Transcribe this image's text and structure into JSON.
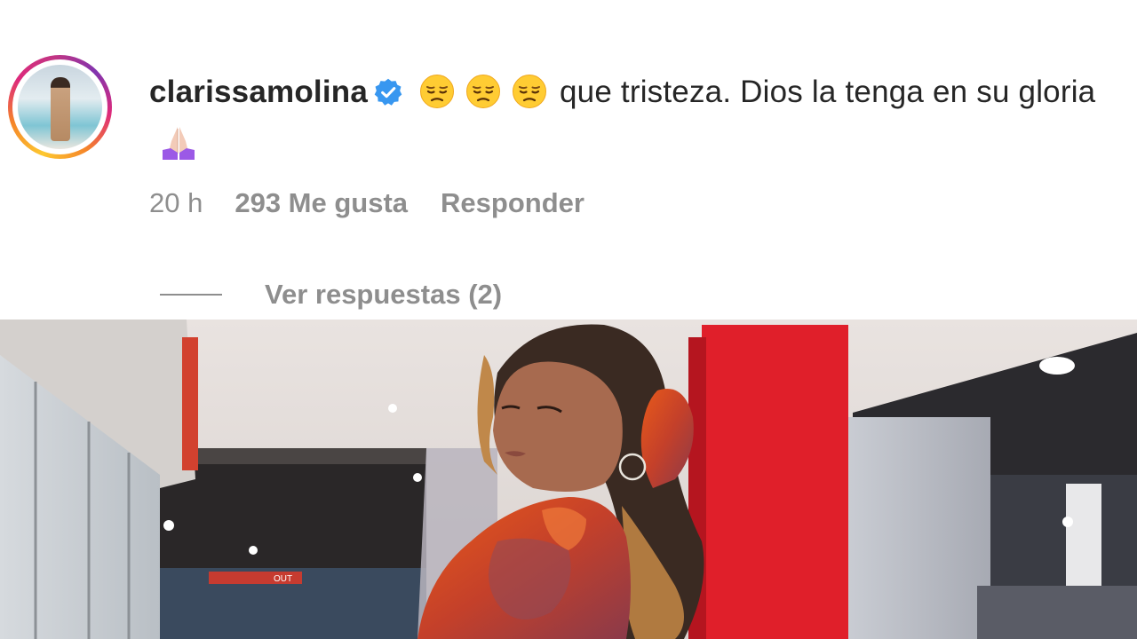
{
  "comment": {
    "username": "clarissamolina",
    "verified_icon": "verified-badge-icon",
    "leading_emojis": [
      "pensive-face-icon",
      "pensive-face-icon",
      "pensive-face-icon"
    ],
    "text": "que tristeza. Dios la tenga en su gloria",
    "trailing_emoji": "folded-hands-icon",
    "time": "20 h",
    "likes": "293 Me gusta",
    "reply_label": "Responder",
    "view_replies": "Ver respuestas (2)"
  },
  "colors": {
    "text_primary": "#262626",
    "text_secondary": "#8e8e8e",
    "verified_blue": "#3897f0",
    "story_ring": [
      "#fdc830",
      "#f58529",
      "#dd2a7b",
      "#8134af"
    ]
  },
  "photo": {
    "sign_text": "OUT"
  }
}
